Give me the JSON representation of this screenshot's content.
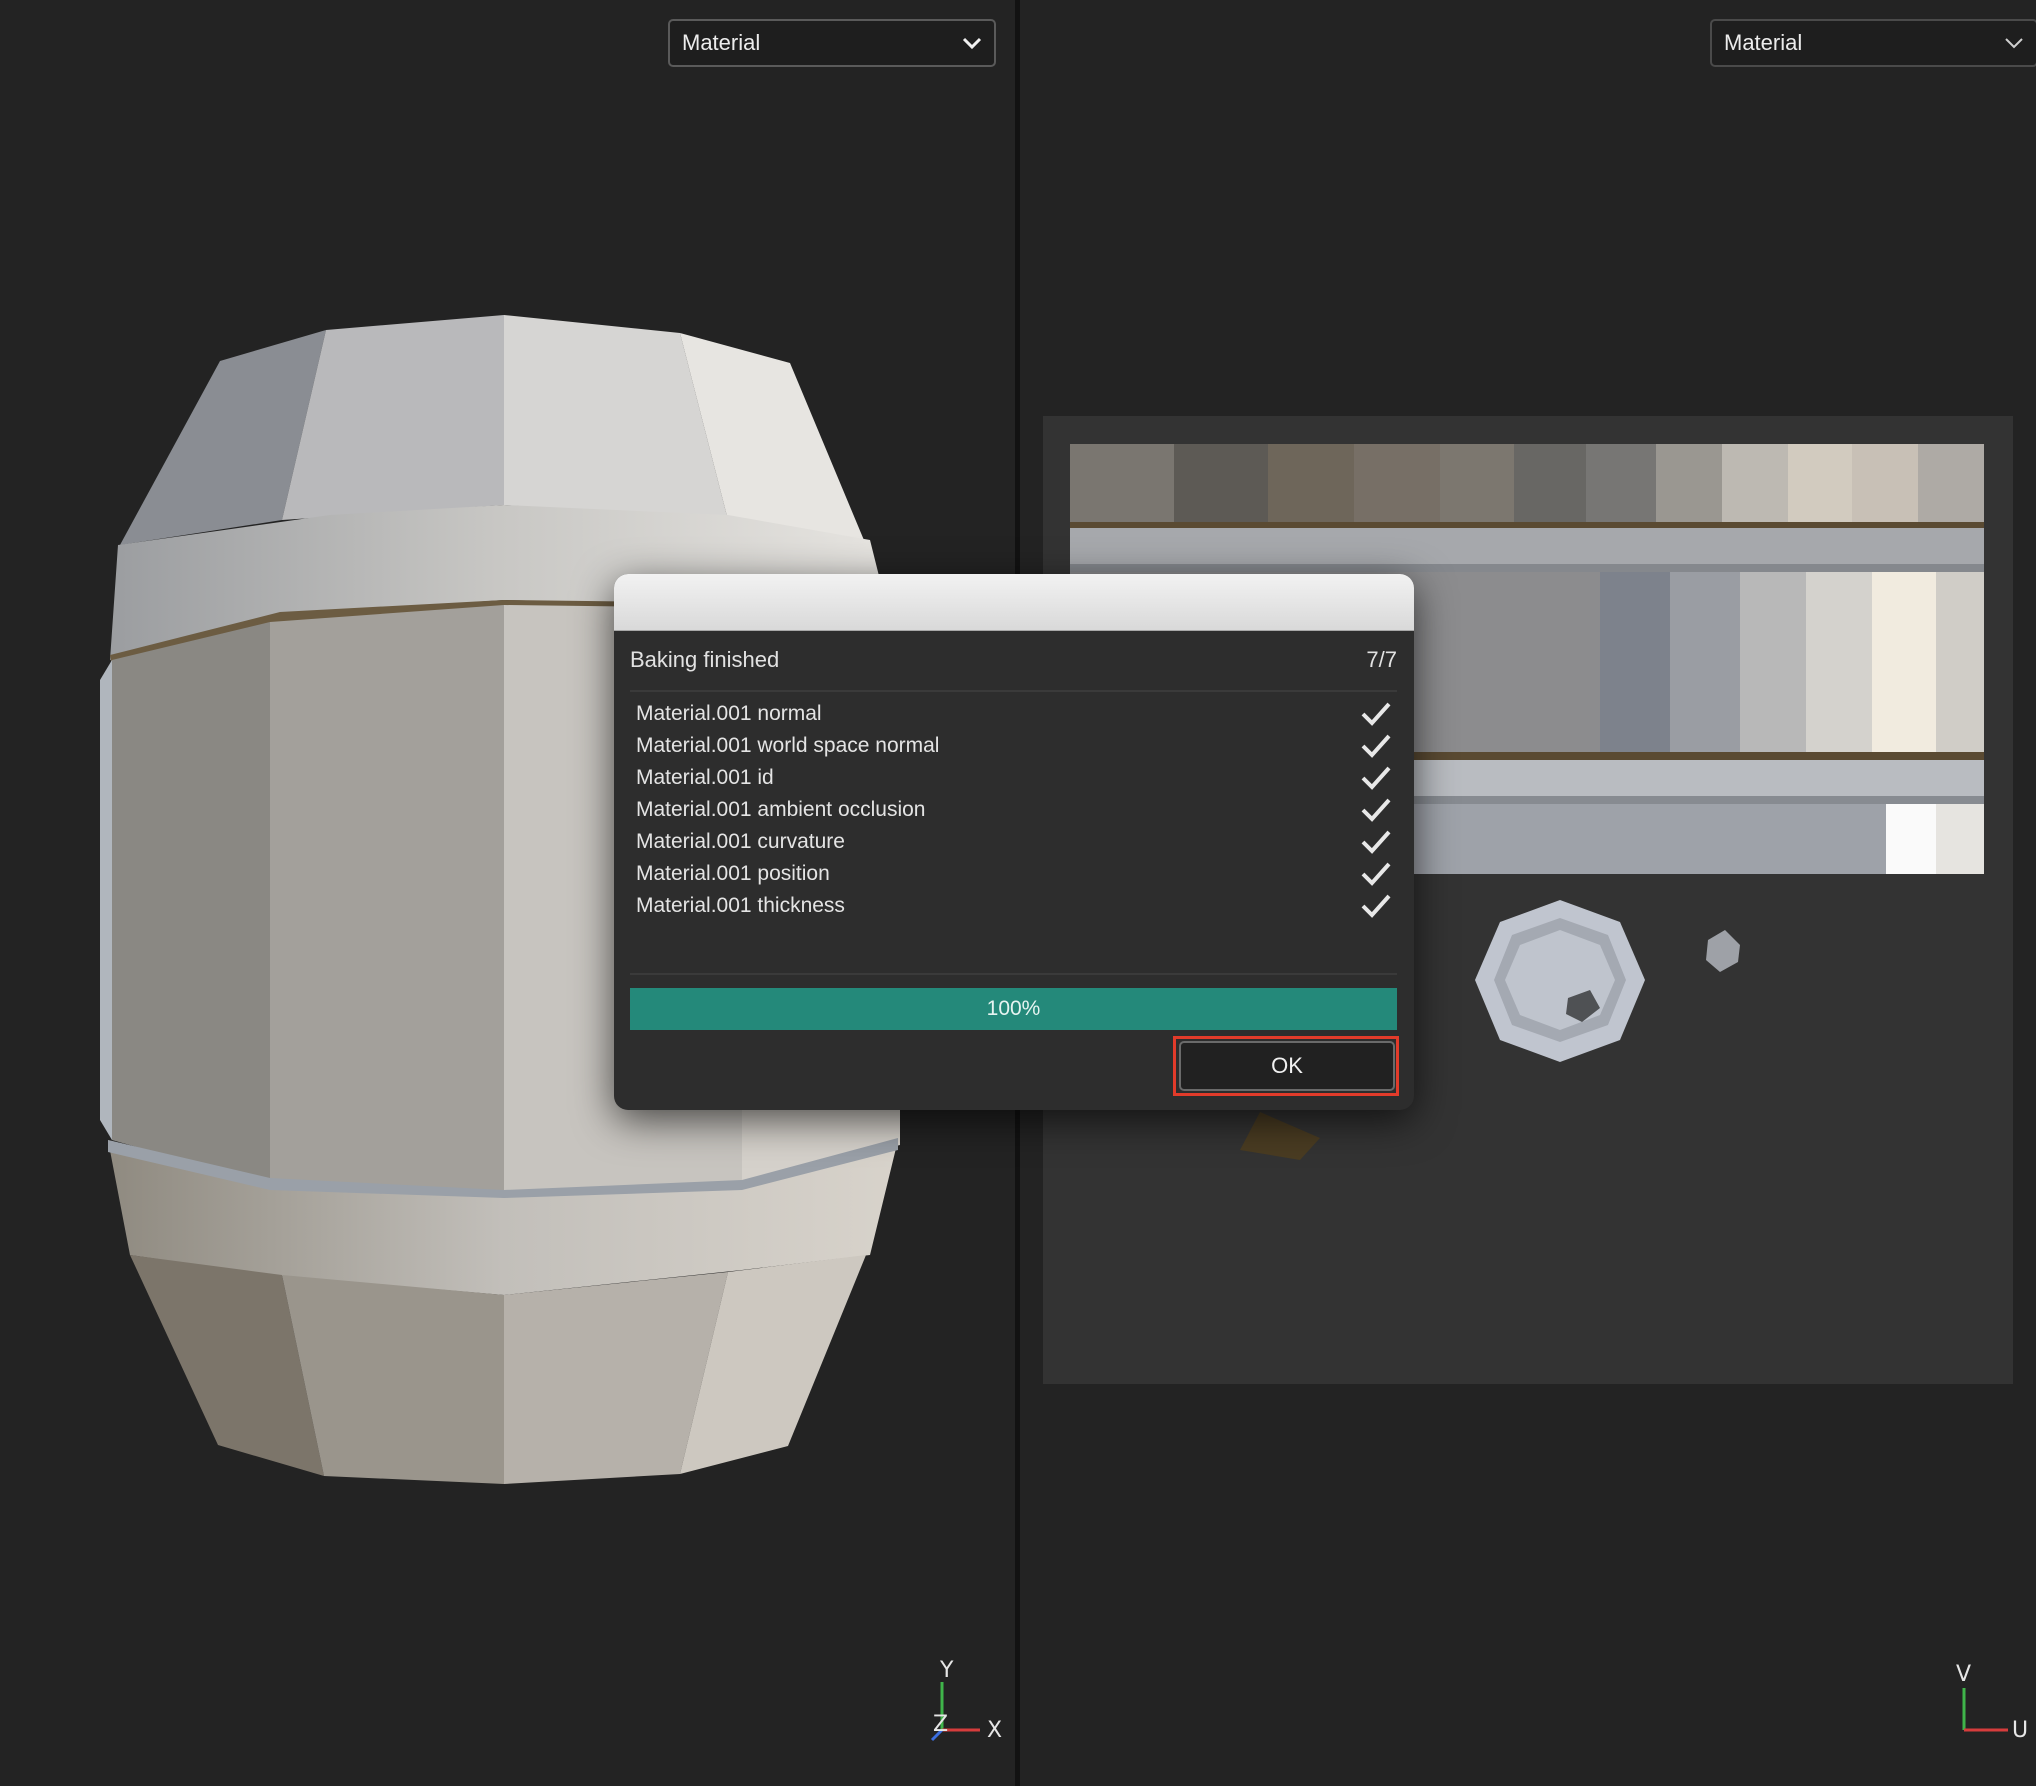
{
  "viewports": {
    "left": {
      "mode_dropdown": "Material",
      "axes": {
        "y": "Y",
        "z": "Z",
        "x": "X"
      }
    },
    "right": {
      "mode_dropdown": "Material",
      "axes": {
        "v": "V",
        "u": "U"
      }
    }
  },
  "dialog": {
    "status": "Baking finished",
    "count": "7/7",
    "tasks": [
      {
        "label": "Material.001 normal",
        "icon": "check-icon",
        "done": true
      },
      {
        "label": "Material.001 world space normal",
        "icon": "check-icon",
        "done": true
      },
      {
        "label": "Material.001 id",
        "icon": "check-icon",
        "done": true
      },
      {
        "label": "Material.001 ambient occlusion",
        "icon": "check-icon",
        "done": true
      },
      {
        "label": "Material.001 curvature",
        "icon": "check-icon",
        "done": true
      },
      {
        "label": "Material.001 position",
        "icon": "check-icon",
        "done": true
      },
      {
        "label": "Material.001 thickness",
        "icon": "check-icon",
        "done": true
      }
    ],
    "progress": {
      "percent": 100,
      "label": "100%"
    },
    "ok_label": "OK"
  },
  "colors": {
    "progress_fill": "#24897a",
    "highlight": "#e23b2a",
    "viewport_bg": "#232323"
  }
}
